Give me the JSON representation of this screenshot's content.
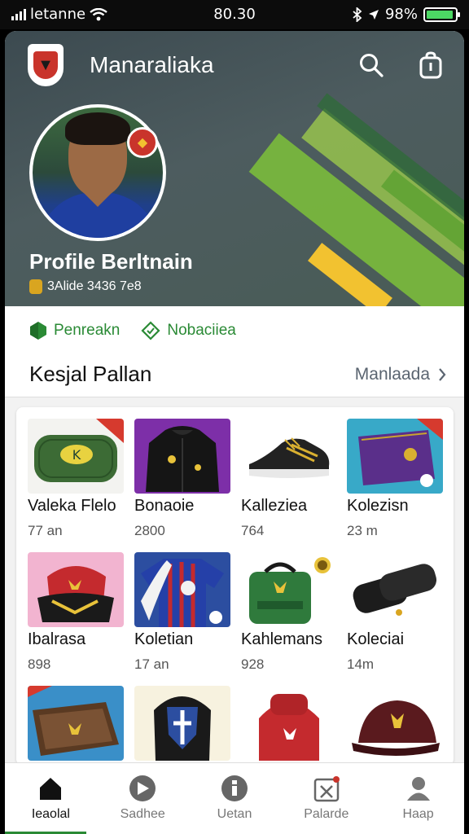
{
  "status_bar": {
    "carrier": "letanne",
    "time": "80.30",
    "battery": "98%",
    "battery_level": 0.95
  },
  "header": {
    "title": "Manaraliaka",
    "search_icon": "search-icon",
    "bag_icon": "shopping-bag-icon"
  },
  "profile": {
    "name": "Profile Berltnain",
    "stat": "3Alide 3436 7e8"
  },
  "tags": [
    {
      "label": "Penreakn",
      "icon": "gem-icon"
    },
    {
      "label": "Nobaciiea",
      "icon": "diamond-outline-icon"
    }
  ],
  "section": {
    "title": "Kesjal Pallan",
    "link": "Manlaada"
  },
  "products": [
    {
      "name": "Valeka Flelo",
      "price": "77 an",
      "icon": "pouch-icon"
    },
    {
      "name": "Bonaoie",
      "price": "2800",
      "icon": "jacket-icon"
    },
    {
      "name": "Kalleziea",
      "price": "764",
      "icon": "sneaker-icon"
    },
    {
      "name": "Kolezisn",
      "price": "23 m",
      "icon": "bag-icon"
    },
    {
      "name": "Ibalrasa",
      "price": "898",
      "icon": "backpack-icon"
    },
    {
      "name": "Koletian",
      "price": "17 an",
      "icon": "jersey-icon"
    },
    {
      "name": "Kahlemans",
      "price": "928",
      "icon": "kitbag-icon"
    },
    {
      "name": "Koleciai",
      "price": "14m",
      "icon": "gloves-icon"
    },
    {
      "name": "",
      "price": "",
      "icon": "board-game-icon"
    },
    {
      "name": "",
      "price": "",
      "icon": "shield-backpack-icon"
    },
    {
      "name": "",
      "price": "",
      "icon": "red-backpack-icon"
    },
    {
      "name": "",
      "price": "",
      "icon": "cap-icon"
    }
  ],
  "tabs": [
    {
      "label": "Ieaolal",
      "icon": "home-icon",
      "active": true
    },
    {
      "label": "Sadhee",
      "icon": "play-icon",
      "active": false
    },
    {
      "label": "Uetan",
      "icon": "info-icon",
      "active": false
    },
    {
      "label": "Palarde",
      "icon": "calendar-icon",
      "active": false
    },
    {
      "label": "Haap",
      "icon": "user-icon",
      "active": false
    }
  ],
  "colors": {
    "accent": "#2a8a35",
    "brand_red": "#c9342b",
    "hero_bg": "#4d5c5f"
  }
}
